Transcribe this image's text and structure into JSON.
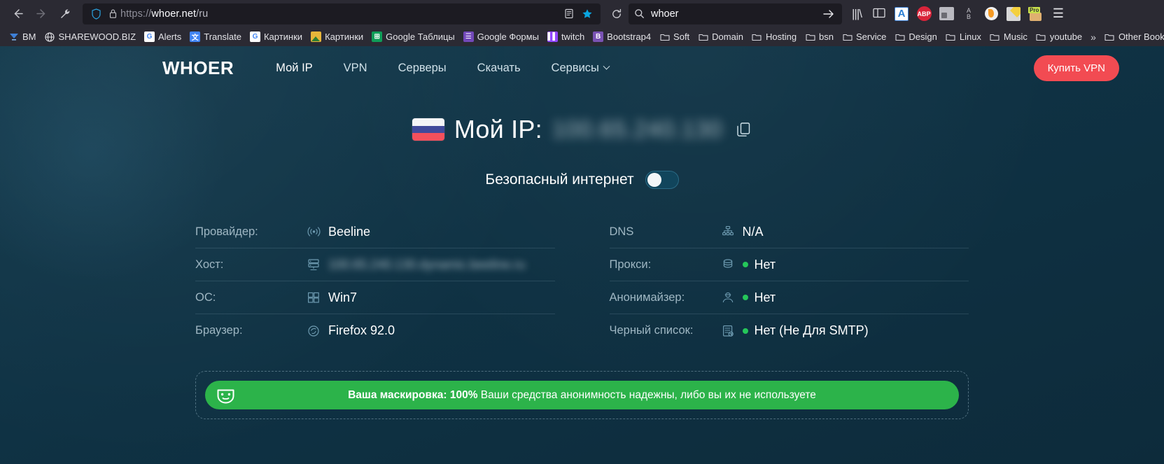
{
  "browser": {
    "back_icon": "back-arrow-icon",
    "forward_icon": "forward-arrow-icon",
    "tools_icon": "wrench-icon",
    "shield_icon": "shield-icon",
    "lock_icon": "lock-icon",
    "url_scheme": "https://",
    "url_host": "whoer.net",
    "url_path": "/ru",
    "reader_icon": "reader-view-icon",
    "bookmark_icon": "star-icon",
    "reload_icon": "reload-icon",
    "search_query": "whoer",
    "search_go_icon": "arrow-right-icon",
    "extensions": [
      {
        "name": "library-icon",
        "label": "|||\\"
      },
      {
        "name": "sidebar-icon",
        "label": ""
      },
      {
        "name": "dictionary-extension-icon",
        "label": "A"
      },
      {
        "name": "adblock-plus-icon",
        "label": "ABP"
      },
      {
        "name": "image-extension-icon",
        "label": ""
      },
      {
        "name": "ab-translate-extension-icon",
        "label": "A\nB"
      },
      {
        "name": "drop-extension-icon",
        "label": ""
      },
      {
        "name": "yellow-extension-icon",
        "label": ""
      },
      {
        "name": "pro-extension-icon",
        "label": "Pro"
      }
    ],
    "menu_icon": "hamburger-menu-icon"
  },
  "bookmarks": {
    "items": [
      {
        "label": "BM",
        "icon": "bm-icon"
      },
      {
        "label": "SHAREWOOD.BIZ",
        "icon": "globe-icon"
      },
      {
        "label": "Alerts",
        "icon": "google-icon"
      },
      {
        "label": "Translate",
        "icon": "google-translate-icon"
      },
      {
        "label": "Картинки",
        "icon": "google-icon"
      },
      {
        "label": "Картинки",
        "icon": "picture-icon"
      },
      {
        "label": "Google Таблицы",
        "icon": "google-sheets-icon"
      },
      {
        "label": "Google Формы",
        "icon": "google-forms-icon"
      },
      {
        "label": "twitch",
        "icon": "twitch-icon"
      },
      {
        "label": "Bootstrap4",
        "icon": "bootstrap-icon"
      },
      {
        "label": "Soft",
        "icon": "folder-icon"
      },
      {
        "label": "Domain",
        "icon": "folder-icon"
      },
      {
        "label": "Hosting",
        "icon": "folder-icon"
      },
      {
        "label": "bsn",
        "icon": "folder-icon"
      },
      {
        "label": "Service",
        "icon": "folder-icon"
      },
      {
        "label": "Design",
        "icon": "folder-icon"
      },
      {
        "label": "Linux",
        "icon": "folder-icon"
      },
      {
        "label": "Music",
        "icon": "folder-icon"
      },
      {
        "label": "youtube",
        "icon": "folder-icon"
      }
    ],
    "overflow_icon": "chevron-double-right-icon",
    "other_bookmarks": "Other Bookmark"
  },
  "site": {
    "logo": "WHOER",
    "nav": [
      {
        "label": "Мой IP",
        "active": true,
        "has_caret": false
      },
      {
        "label": "VPN",
        "active": false,
        "has_caret": false
      },
      {
        "label": "Серверы",
        "active": false,
        "has_caret": false
      },
      {
        "label": "Скачать",
        "active": false,
        "has_caret": false
      },
      {
        "label": "Сервисы",
        "active": false,
        "has_caret": true
      }
    ],
    "buy_button": "Купить VPN"
  },
  "hero": {
    "flag": "russia-flag",
    "ip_label": "Мой IP:",
    "ip_value": "100.65.240.130",
    "copy_icon": "copy-icon",
    "toggle_label": "Безопасный интернет",
    "toggle_state": "off"
  },
  "info": {
    "left": [
      {
        "key": "Провайдер:",
        "icon": "wifi-signal-icon",
        "value": "Beeline",
        "blurred": false,
        "status": false
      },
      {
        "key": "Хост:",
        "icon": "server-icon",
        "value": "100.65.240.130.dynamic.beeline.ru",
        "blurred": true,
        "status": false
      },
      {
        "key": "ОС:",
        "icon": "windows-icon",
        "value": "Win7",
        "blurred": false,
        "status": false
      },
      {
        "key": "Браузер:",
        "icon": "firefox-icon",
        "value": "Firefox 92.0",
        "blurred": false,
        "status": false
      }
    ],
    "right": [
      {
        "key": "DNS",
        "icon": "network-tree-icon",
        "value": "N/A",
        "blurred": false,
        "status": false
      },
      {
        "key": "Прокси:",
        "icon": "database-icon",
        "value": "Нет",
        "blurred": false,
        "status": true
      },
      {
        "key": "Анонимайзер:",
        "icon": "anonymous-user-icon",
        "value": "Нет",
        "blurred": false,
        "status": true
      },
      {
        "key": "Черный список:",
        "icon": "blacklist-icon",
        "value": "Нет (Не Для SMTP)",
        "blurred": false,
        "status": true
      }
    ]
  },
  "banner": {
    "icon": "mask-icon",
    "title": "Ваша маскировка: 100%",
    "text": " Ваши средства анонимность надежны, либо вы их не используете"
  },
  "colors": {
    "accent_red": "#f24b52",
    "banner_green": "#2cb34a",
    "status_green": "#25c75a",
    "page_bg": "#0f3244",
    "chrome_bg": "#2b2a33"
  }
}
